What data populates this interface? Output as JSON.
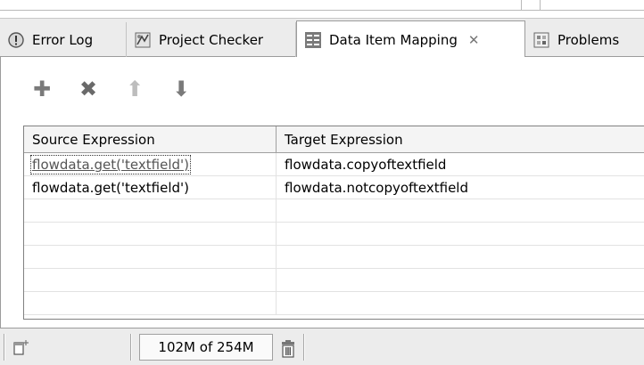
{
  "tabs": [
    {
      "label": "Error Log",
      "icon": "error-log-icon"
    },
    {
      "label": "Project Checker",
      "icon": "project-checker-icon"
    },
    {
      "label": "Data Item Mapping",
      "icon": "data-item-mapping-icon",
      "active": true,
      "close": "✕"
    },
    {
      "label": "Problems",
      "icon": "problems-icon"
    }
  ],
  "toolbar": {
    "add": {
      "glyph": "✚",
      "icon": "add-icon",
      "color": "#7a7a7a"
    },
    "remove": {
      "glyph": "✖",
      "icon": "remove-icon",
      "color": "#6a6a6a"
    },
    "move_up": {
      "glyph": "⬆",
      "icon": "move-up-icon",
      "color": "#bdbdbd"
    },
    "move_down": {
      "glyph": "⬇",
      "icon": "move-down-icon",
      "color": "#7a7a7a"
    }
  },
  "table": {
    "columns": [
      "Source Expression",
      "Target Expression"
    ],
    "rows": [
      {
        "source": "flowdata.get('textfield')",
        "target": "flowdata.copyoftextfield"
      },
      {
        "source": "flowdata.get('textfield')",
        "target": "flowdata.notcopyoftextfield"
      }
    ]
  },
  "status": {
    "memory": "102M of 254M",
    "trash_icon": "trash-icon",
    "fast_view_icon": "fast-view-icon"
  }
}
